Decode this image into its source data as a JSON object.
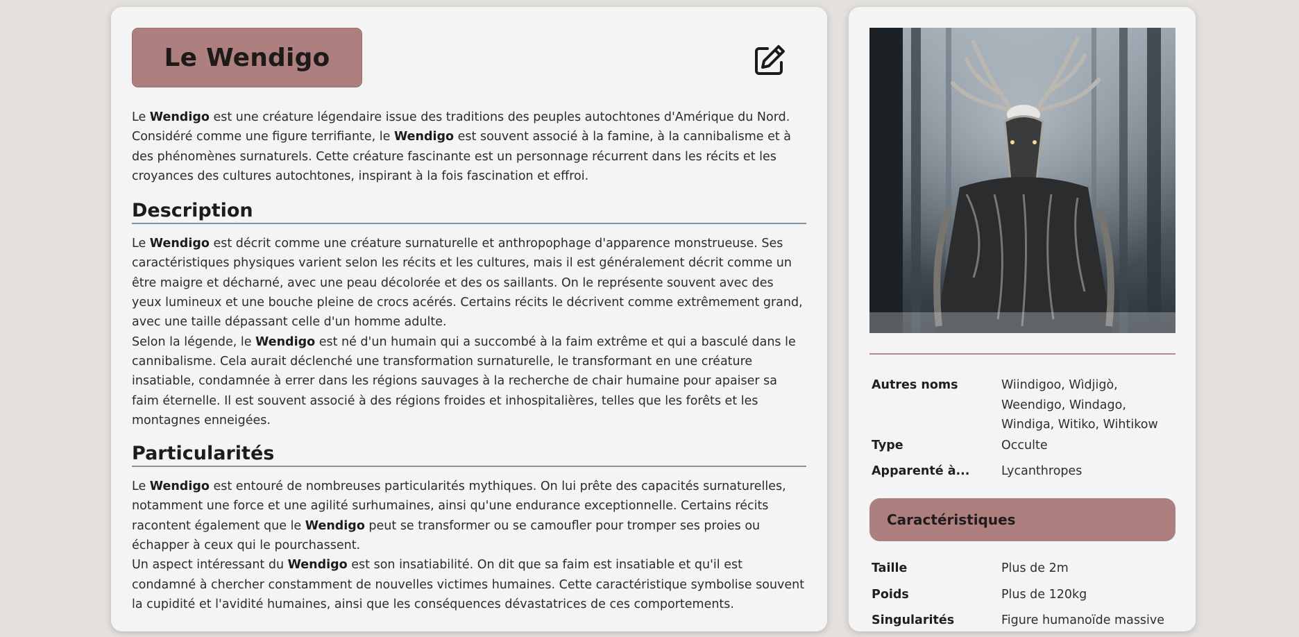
{
  "article": {
    "title": "Le Wendigo",
    "edit_icon": "edit-pencil-icon",
    "intro": [
      {
        "t": "Le "
      },
      {
        "t": "Wendigo",
        "b": true
      },
      {
        "t": " est une créature légendaire issue des traditions des peuples autochtones d'Amérique du Nord. Considéré comme une figure terrifiante, le "
      },
      {
        "t": "Wendigo",
        "b": true
      },
      {
        "t": " est souvent associé à la famine, à la cannibalisme et à des phénomènes surnaturels. Cette créature fascinante est un personnage récurrent dans les récits et les croyances des cultures autochtones, inspirant à la fois fascination et effroi."
      }
    ],
    "sections": [
      {
        "heading": "Description",
        "paragraphs": [
          [
            {
              "t": "Le "
            },
            {
              "t": "Wendigo",
              "b": true
            },
            {
              "t": " est décrit comme une créature surnaturelle et anthropophage d'apparence monstrueuse. Ses caractéristiques physiques varient selon les récits et les cultures, mais il est généralement décrit comme un être maigre et décharné, avec une peau décolorée et des os saillants. On le représente souvent avec des yeux lumineux et une bouche pleine de crocs acérés. Certains récits le décrivent comme extrêmement grand, avec une taille dépassant celle d'un homme adulte."
            }
          ],
          [
            {
              "t": "Selon la légende, le "
            },
            {
              "t": "Wendigo",
              "b": true
            },
            {
              "t": " est né d'un humain qui a succombé à la faim extrême et qui a basculé dans le cannibalisme. Cela aurait déclenché une transformation surnaturelle, le transformant en une créature insatiable, condamnée à errer dans les régions sauvages à la recherche de chair humaine pour apaiser sa faim éternelle. Il est souvent associé à des régions froides et inhospitalières, telles que les forêts et les montagnes enneigées."
            }
          ]
        ]
      },
      {
        "heading": "Particularités",
        "paragraphs": [
          [
            {
              "t": "Le "
            },
            {
              "t": "Wendigo",
              "b": true
            },
            {
              "t": " est entouré de nombreuses particularités mythiques. On lui prête des capacités surnaturelles, notamment une force et une agilité surhumaines, ainsi qu'une endurance exceptionnelle. Certains récits racontent également que le "
            },
            {
              "t": "Wendigo",
              "b": true
            },
            {
              "t": " peut se transformer ou se camoufler pour tromper ses proies ou échapper à ceux qui le pourchassent."
            }
          ],
          [
            {
              "t": "Un aspect intéressant du "
            },
            {
              "t": "Wendigo",
              "b": true
            },
            {
              "t": " est son insatiabilité. On dit que sa faim est insatiable et qu'il est condamné à chercher constamment de nouvelles victimes humaines. Cette caractéristique symbolise souvent la cupidité et l'avidité humaines, ainsi que les conséquences dévastatrices de ces comportements."
            }
          ]
        ]
      }
    ]
  },
  "sidebar": {
    "image_icon": "wendigo-portrait-image",
    "info": [
      {
        "key": "Autres noms",
        "value": "Wiindigoo, Wìdjigò, Weendigo, Windago, Windiga, Witiko, Wihtikow"
      },
      {
        "key": "Type",
        "value": "Occulte"
      },
      {
        "key": "Apparenté à...",
        "value": "Lycanthropes"
      }
    ],
    "characteristics_title": "Caractéristiques",
    "characteristics": [
      {
        "key": "Taille",
        "value": "Plus de 2m"
      },
      {
        "key": "Poids",
        "value": "Plus de 120kg"
      },
      {
        "key": "Singularités",
        "value": "Figure humanoïde massive"
      }
    ]
  },
  "colors": {
    "accent": "#ad7f7f",
    "heading_rule": "#7f93a4",
    "background": "#e3e0dd",
    "panel": "#f4f4f4"
  }
}
